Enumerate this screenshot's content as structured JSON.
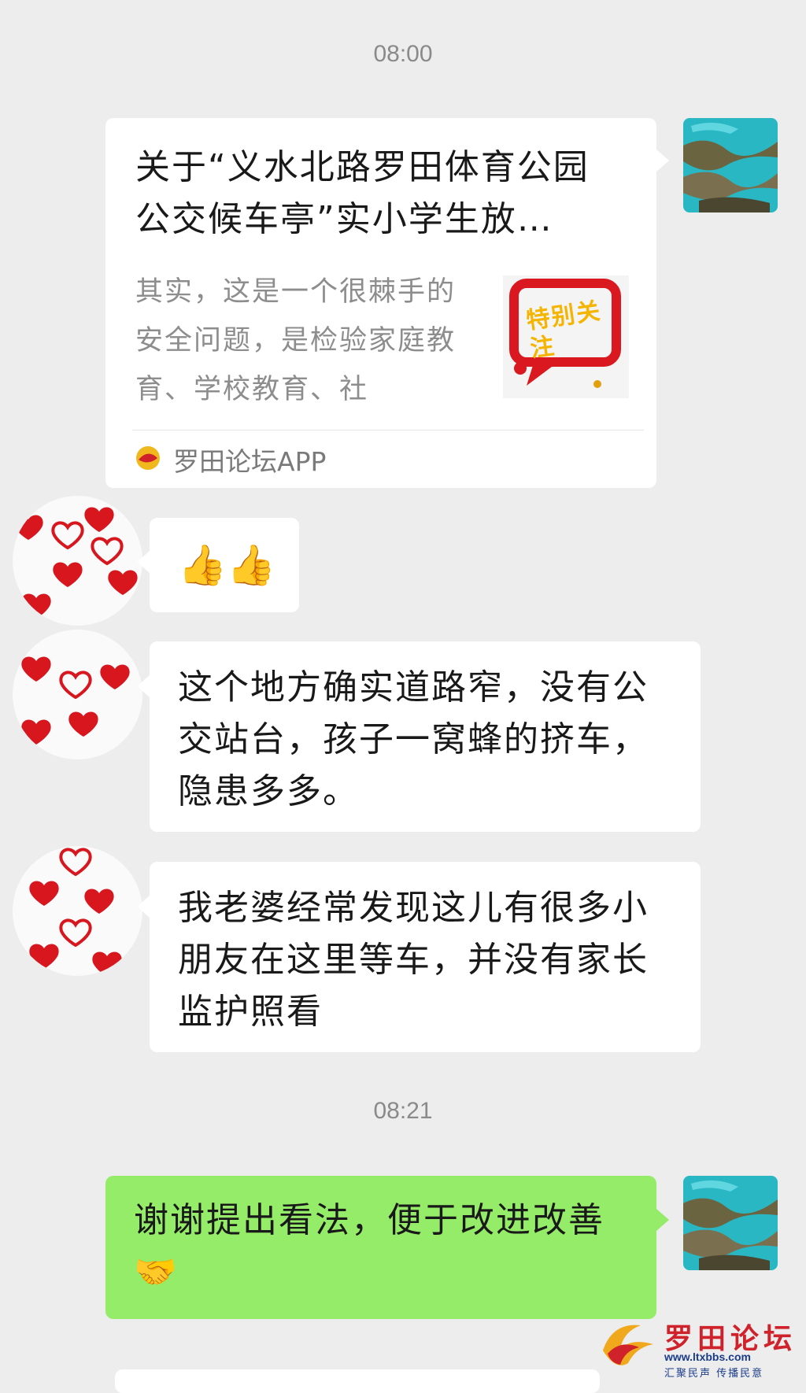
{
  "chat": {
    "timestamp_1": "08:00",
    "timestamp_2": "08:21",
    "card": {
      "title": "关于“义水北路罗田体育公园公交候车亭”实小学生放…",
      "description": "其实，这是一个很棘手的安全问题，是检验家庭教育、学校教育、社",
      "thumb_text": "特别关注",
      "source": "罗田论坛APP"
    },
    "messages": [
      {
        "text": "👍👍"
      },
      {
        "text": "这个地方确实道路窄，没有公交站台，孩子一窝蜂的挤车，隐患多多。"
      },
      {
        "text": "我老婆经常发现这儿有很多小朋友在这里等车，并没有家长监护照看"
      },
      {
        "text": "谢谢提出看法，便于改进改善🤝"
      }
    ]
  },
  "watermark": {
    "name": "罗田论坛",
    "url": "www.ltxbbs.com",
    "slogan": "汇聚民声 传播民意"
  },
  "colors": {
    "background": "#ededed",
    "bubble_self": "#95ec69",
    "bubble_other": "#ffffff",
    "brand_red": "#d0222a"
  }
}
